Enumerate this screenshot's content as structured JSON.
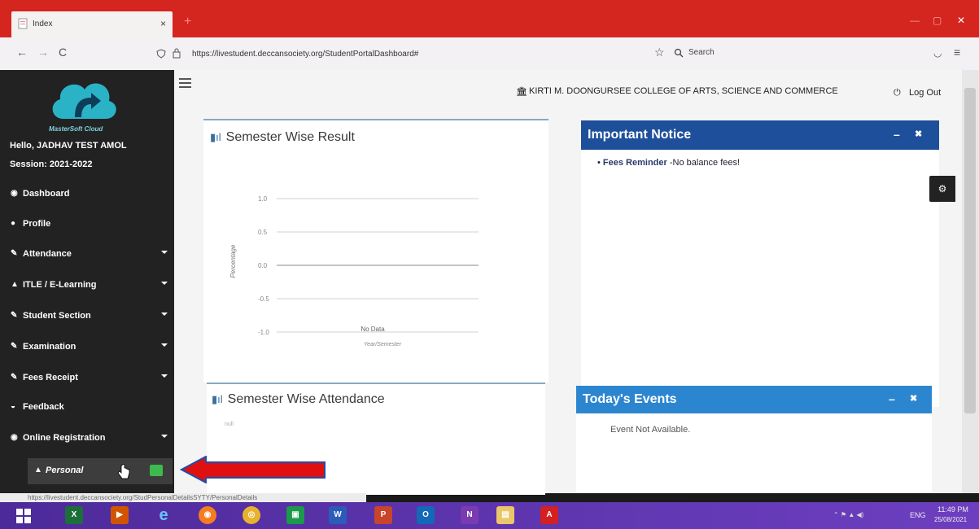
{
  "browser": {
    "tab_title": "Index",
    "tab_close": "×",
    "new_tab": "+",
    "url": "https://livestudent.deccansociety.org/StudentPortalDashboard#",
    "search_placeholder": "Search",
    "back": "←",
    "forward": "→",
    "reload": "C"
  },
  "header": {
    "college": "KIRTI M. DOONGURSEE COLLEGE OF ARTS, SCIENCE AND COMMERCE",
    "logout": "Log Out"
  },
  "sidebar": {
    "brand": "MasterSoft Cloud",
    "greeting": "Hello, JADHAV TEST AMOL",
    "session": "Session: 2021-2022",
    "items": [
      {
        "label": "Dashboard",
        "icon": "dashboard-icon",
        "glyph": "◉",
        "caret": false
      },
      {
        "label": "Profile",
        "icon": "user-circle-icon",
        "glyph": "●",
        "caret": false
      },
      {
        "label": "Attendance",
        "icon": "pencil-icon",
        "glyph": "✎",
        "caret": true
      },
      {
        "label": "ITLE / E-Learning",
        "icon": "graduation-cap-icon",
        "glyph": "▲",
        "caret": true
      },
      {
        "label": "Student Section",
        "icon": "pencil-icon",
        "glyph": "✎",
        "caret": true
      },
      {
        "label": "Examination",
        "icon": "pencil-icon",
        "glyph": "✎",
        "caret": true
      },
      {
        "label": "Fees Receipt",
        "icon": "pencil-icon",
        "glyph": "✎",
        "caret": true
      },
      {
        "label": "Feedback",
        "icon": "comments-icon",
        "glyph": "◒",
        "caret": false
      },
      {
        "label": "Online Registration",
        "icon": "circle-icon",
        "glyph": "◉",
        "caret": true
      }
    ],
    "subitem": {
      "label": "Personal",
      "icon": "user-icon"
    }
  },
  "semester_result": {
    "title": "Semester Wise Result",
    "y_label": "Percentage",
    "x_label": "Year/Semester",
    "no_data": "No Data",
    "ticks": [
      "1.0",
      "0.5",
      "0.0",
      "-0.5",
      "-1.0"
    ]
  },
  "semester_attendance": {
    "title": "Semester Wise Attendance",
    "value": "null"
  },
  "notice": {
    "title": "Important Notice",
    "item_bold": "Fees Reminder",
    "item_text": " -No balance fees!"
  },
  "events": {
    "title": "Today's Events",
    "text": "Event Not Available."
  },
  "status_bar": "https://livestudent.deccansociety.org/StudPersonalDetailsSYTY/PersonalDetails",
  "tray": {
    "lang": "ENG",
    "time": "11:49 PM",
    "date": "25/08/2021"
  },
  "colors": {
    "notice_header": "#1e4f9a",
    "events_header": "#2c86cf",
    "sidebar": "#222222",
    "arrow": "#e01010"
  }
}
